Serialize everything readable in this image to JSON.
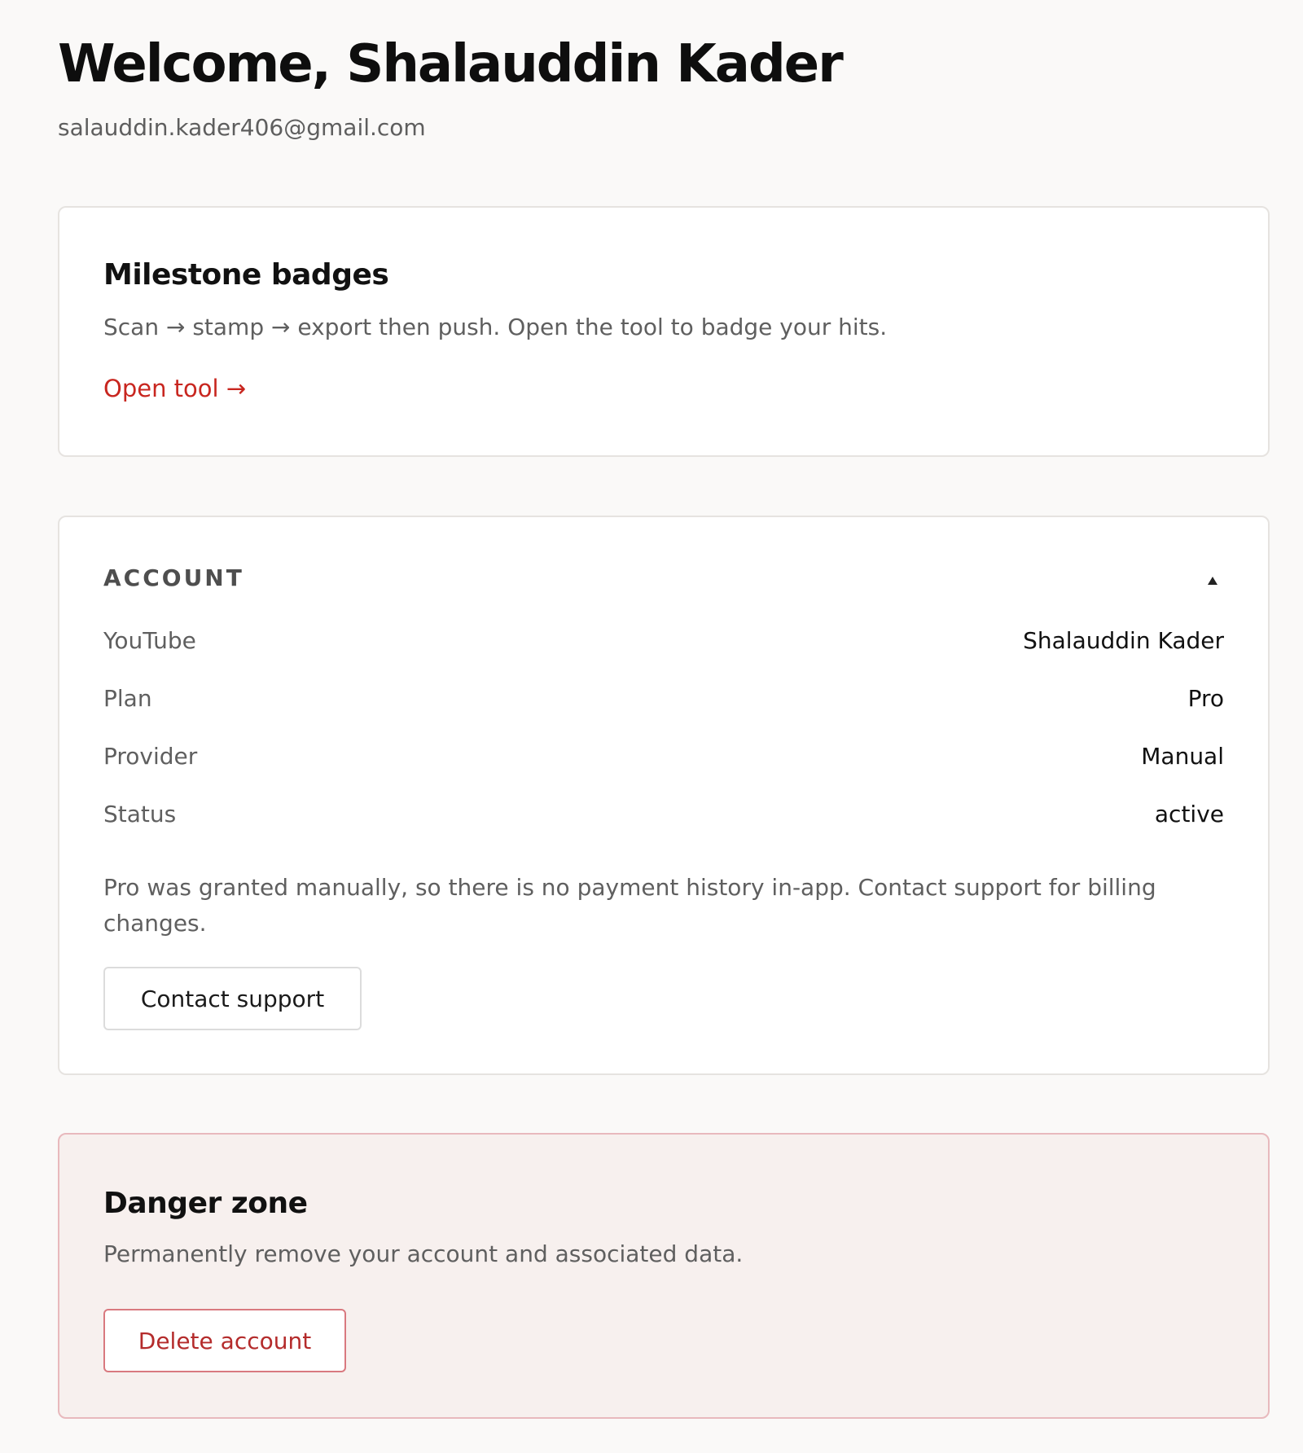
{
  "header": {
    "title": "Welcome, Shalauddin Kader",
    "email": "salauddin.kader406@gmail.com"
  },
  "milestone": {
    "title": "Milestone badges",
    "description": "Scan → stamp → export then push. Open the tool to badge your hits.",
    "link_label": "Open tool →"
  },
  "account": {
    "section_label": "ACCOUNT",
    "toggle_icon": "caret-up-icon",
    "rows": [
      {
        "label": "YouTube",
        "value": "Shalauddin Kader"
      },
      {
        "label": "Plan",
        "value": "Pro"
      },
      {
        "label": "Provider",
        "value": "Manual"
      },
      {
        "label": "Status",
        "value": "active"
      }
    ],
    "note": "Pro was granted manually, so there is no payment history in-app. Contact support for billing changes.",
    "contact_button": "Contact support"
  },
  "danger": {
    "title": "Danger zone",
    "description": "Permanently remove your account and associated data.",
    "delete_button": "Delete account"
  },
  "colors": {
    "background": "#faf9f8",
    "accent_link": "#c8261f",
    "danger_border": "#e8b9bd",
    "danger_background": "#f7f0ee",
    "danger_text": "#b42b2b"
  }
}
